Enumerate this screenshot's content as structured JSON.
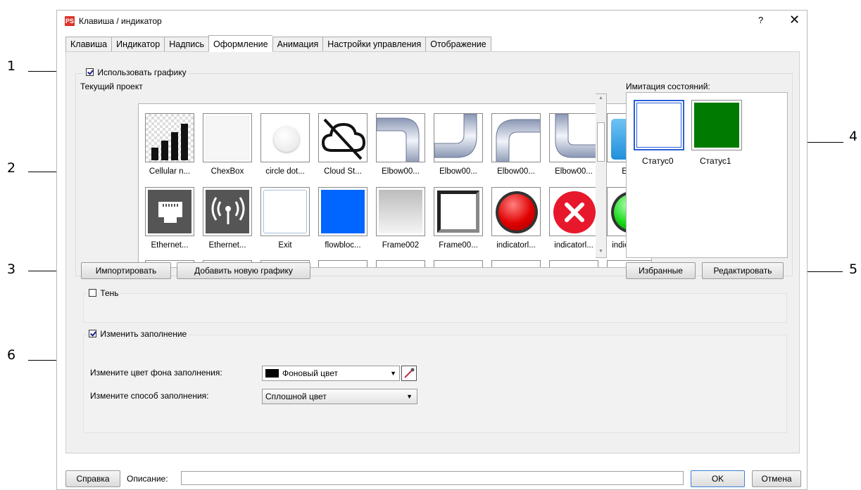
{
  "window": {
    "title": "Клавиша / индикатор",
    "icon_text": "PS",
    "help_label": "?",
    "close_label": "✕"
  },
  "tabs": [
    "Клавиша",
    "Индикатор",
    "Надпись",
    "Оформление",
    "Анимация",
    "Настройки управления",
    "Отображение"
  ],
  "active_tab": "Оформление",
  "use_graphics": {
    "label": "Использовать графику",
    "checked": true
  },
  "current_project_label": "Текущий проект",
  "gallery": {
    "row1": [
      "Cellular n...",
      "ChexBox",
      "circle dot...",
      "Cloud St...",
      "Elbow00...",
      "Elbow00...",
      "Elbow00...",
      "Elbow00...",
      "Enter"
    ],
    "row2": [
      "Ethernet...",
      "Ethernet...",
      "Exit",
      "flowbloc...",
      "Frame002",
      "Frame00...",
      "indicatorl...",
      "indicatorl...",
      "indicatorl..."
    ]
  },
  "states": {
    "label": "Имитация состояний:",
    "items": [
      "Статус0",
      "Статус1"
    ]
  },
  "buttons": {
    "import": "Импортировать",
    "add_graphic": "Добавить новую графику",
    "favorites": "Избранные",
    "edit": "Редактировать"
  },
  "shadow": {
    "label": "Тень",
    "checked": false
  },
  "change_fill": {
    "label": "Изменить заполнение",
    "checked": true
  },
  "fill_color": {
    "label": "Измените цвет фона заполнения:",
    "value": "Фоновый цвет",
    "swatch": "#000000"
  },
  "fill_method": {
    "label": "Измените способ заполнения:",
    "value": "Сплошной цвет"
  },
  "footer": {
    "help": "Справка",
    "description_label": "Описание:",
    "description_value": "",
    "ok": "OK",
    "cancel": "Отмена"
  },
  "callouts": [
    "1",
    "2",
    "3",
    "4",
    "5",
    "6"
  ]
}
